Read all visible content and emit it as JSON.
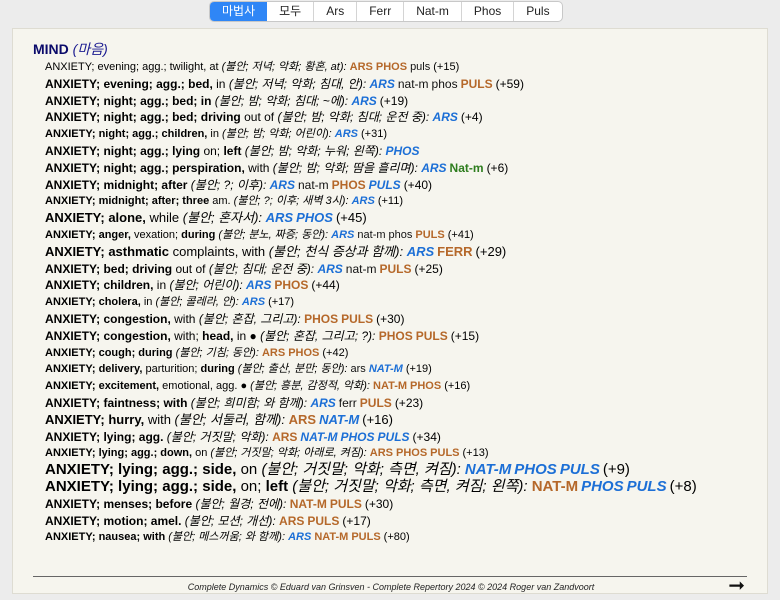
{
  "tabs": [
    {
      "label": "마법사",
      "active": true
    },
    {
      "label": "모두",
      "active": false
    },
    {
      "label": "Ars",
      "active": false
    },
    {
      "label": "Ferr",
      "active": false
    },
    {
      "label": "Nat-m",
      "active": false
    },
    {
      "label": "Phos",
      "active": false
    },
    {
      "label": "Puls",
      "active": false
    }
  ],
  "chapter": {
    "title": "MIND",
    "translation": "(마음)"
  },
  "rubrics": [
    {
      "size": 11,
      "parts": [
        {
          "t": "ANXIETY; evening; agg.; twilight, at ",
          "b": false
        }
      ],
      "tr": "(불안; 저녁; 악화; 황혼, at):",
      "rem": [
        [
          "ARS",
          "brown",
          1
        ],
        [
          "PHOS",
          "brown",
          1
        ],
        [
          "puls",
          "black",
          0
        ]
      ],
      "count": "(+15)"
    },
    {
      "size": 12,
      "parts": [
        {
          "t": "ANXIETY; evening; agg.; bed, ",
          "b": true
        },
        {
          "t": "in ",
          "b": false
        }
      ],
      "tr": "(불안; 저녁; 악화; 침대, 안):",
      "rem": [
        [
          "ARS",
          "blue",
          1
        ],
        [
          "nat-m",
          "black",
          0
        ],
        [
          "phos",
          "black",
          0
        ],
        [
          "PULS",
          "brown",
          1
        ]
      ],
      "count": "(+59)"
    },
    {
      "size": 12,
      "parts": [
        {
          "t": "ANXIETY; night; agg.; bed; in ",
          "b": true
        }
      ],
      "tr": "(불안; 밤; 악화; 침대; ~에):",
      "rem": [
        [
          "ARS",
          "blue",
          1
        ]
      ],
      "count": "(+19)"
    },
    {
      "size": 12,
      "parts": [
        {
          "t": "ANXIETY; night; agg.; bed; driving ",
          "b": true
        },
        {
          "t": "out of ",
          "b": false
        }
      ],
      "tr": "(불안; 밤; 악화; 침대; 운전 중):",
      "rem": [
        [
          "ARS",
          "blue",
          1
        ]
      ],
      "count": "(+4)"
    },
    {
      "size": 11,
      "parts": [
        {
          "t": "ANXIETY; night; agg.; children, ",
          "b": true
        },
        {
          "t": "in ",
          "b": false
        }
      ],
      "tr": "(불안; 밤; 악화; 어린이):",
      "rem": [
        [
          "ARS",
          "blue",
          1
        ]
      ],
      "count": "(+31)"
    },
    {
      "size": 12,
      "parts": [
        {
          "t": "ANXIETY; night; agg.; lying ",
          "b": true
        },
        {
          "t": "on; ",
          "b": false
        },
        {
          "t": "left ",
          "b": true
        }
      ],
      "tr": "(불안; 밤; 악화; 누워; 왼쪽):",
      "rem": [
        [
          "PHOS",
          "blue",
          1
        ]
      ],
      "count": ""
    },
    {
      "size": 12,
      "parts": [
        {
          "t": "ANXIETY; night; agg.; perspiration, ",
          "b": true
        },
        {
          "t": "with ",
          "b": false
        }
      ],
      "tr": "(불안; 밤; 악화; 땀을 흘리며):",
      "rem": [
        [
          "ARS",
          "blue",
          1
        ],
        [
          "Nat-m",
          "green",
          1
        ]
      ],
      "count": "(+6)"
    },
    {
      "size": 12,
      "parts": [
        {
          "t": "ANXIETY; midnight; after ",
          "b": true
        }
      ],
      "tr": "(불안; ?; 이후):",
      "rem": [
        [
          "ARS",
          "blue",
          1
        ],
        [
          "nat-m",
          "black",
          0
        ],
        [
          "PHOS",
          "brown",
          1
        ],
        [
          "PULS",
          "blue",
          1
        ]
      ],
      "count": "(+40)"
    },
    {
      "size": 11,
      "parts": [
        {
          "t": "ANXIETY; midnight; after; three ",
          "b": true
        },
        {
          "t": "am. ",
          "b": false
        }
      ],
      "tr": "(불안; ?; 이후; 새벽 3시):",
      "rem": [
        [
          "ARS",
          "blue",
          1
        ]
      ],
      "count": "(+11)"
    },
    {
      "size": 13,
      "parts": [
        {
          "t": "ANXIETY; alone, ",
          "b": true
        },
        {
          "t": "while ",
          "b": false
        }
      ],
      "tr": "(불안; 혼자서):",
      "rem": [
        [
          "ARS",
          "blue",
          1
        ],
        [
          "PHOS",
          "blue",
          1
        ]
      ],
      "count": "(+45)"
    },
    {
      "size": 11,
      "parts": [
        {
          "t": "ANXIETY; anger, ",
          "b": true
        },
        {
          "t": "vexation; ",
          "b": false
        },
        {
          "t": "during ",
          "b": true
        }
      ],
      "tr": "(불안; 분노, 짜증; 동안):",
      "rem": [
        [
          "ARS",
          "blue",
          1
        ],
        [
          "nat-m",
          "black",
          0
        ],
        [
          "phos",
          "black",
          0
        ],
        [
          "PULS",
          "brown",
          1
        ]
      ],
      "count": "(+41)"
    },
    {
      "size": 13,
      "parts": [
        {
          "t": "ANXIETY; asthmatic ",
          "b": true
        },
        {
          "t": "complaints, with ",
          "b": false
        }
      ],
      "tr": "(불안; 천식 증상과 함께):",
      "rem": [
        [
          "ARS",
          "blue",
          1
        ],
        [
          "FERR",
          "brown",
          1
        ]
      ],
      "count": "(+29)"
    },
    {
      "size": 12,
      "parts": [
        {
          "t": "ANXIETY; bed; driving ",
          "b": true
        },
        {
          "t": "out of ",
          "b": false
        }
      ],
      "tr": "(불안; 침대; 운전 중):",
      "rem": [
        [
          "ARS",
          "blue",
          1
        ],
        [
          "nat-m",
          "black",
          0
        ],
        [
          "PULS",
          "brown",
          1
        ]
      ],
      "count": "(+25)"
    },
    {
      "size": 12,
      "parts": [
        {
          "t": "ANXIETY; children, ",
          "b": true
        },
        {
          "t": "in ",
          "b": false
        }
      ],
      "tr": "(불안; 어린이):",
      "rem": [
        [
          "ARS",
          "blue",
          1
        ],
        [
          "PHOS",
          "brown",
          1
        ]
      ],
      "count": "(+44)"
    },
    {
      "size": 11,
      "parts": [
        {
          "t": "ANXIETY; cholera, ",
          "b": true
        },
        {
          "t": "in ",
          "b": false
        }
      ],
      "tr": "(불안; 콜레라, 안):",
      "rem": [
        [
          "ARS",
          "blue",
          1
        ]
      ],
      "count": "(+17)"
    },
    {
      "size": 12,
      "parts": [
        {
          "t": "ANXIETY; congestion, ",
          "b": true
        },
        {
          "t": "with ",
          "b": false
        }
      ],
      "tr": "(불안; 혼잡, 그리고):",
      "rem": [
        [
          "PHOS",
          "brown",
          1
        ],
        [
          "PULS",
          "brown",
          1
        ]
      ],
      "count": "(+30)"
    },
    {
      "size": 12,
      "parts": [
        {
          "t": "ANXIETY; congestion, ",
          "b": true
        },
        {
          "t": "with; ",
          "b": false
        },
        {
          "t": "head, ",
          "b": true
        },
        {
          "t": "in ● ",
          "b": false
        }
      ],
      "tr": "(불안; 혼잡, 그리고; ?):",
      "rem": [
        [
          "PHOS",
          "brown",
          1
        ],
        [
          "PULS",
          "brown",
          1
        ]
      ],
      "count": "(+15)"
    },
    {
      "size": 11,
      "parts": [
        {
          "t": "ANXIETY; cough; during ",
          "b": true
        }
      ],
      "tr": "(불안; 기침; 동안):",
      "rem": [
        [
          "ARS",
          "brown",
          1
        ],
        [
          "PHOS",
          "brown",
          1
        ]
      ],
      "count": "(+42)"
    },
    {
      "size": 11,
      "parts": [
        {
          "t": "ANXIETY; delivery, ",
          "b": true
        },
        {
          "t": "parturition; ",
          "b": false
        },
        {
          "t": "during ",
          "b": true
        }
      ],
      "tr": "(불안; 출산, 분만; 동안):",
      "rem": [
        [
          "ars",
          "black",
          0
        ],
        [
          "NAT-M",
          "blue",
          1
        ]
      ],
      "count": "(+19)"
    },
    {
      "size": 11,
      "parts": [
        {
          "t": "ANXIETY; excitement, ",
          "b": true
        },
        {
          "t": "emotional, agg. ● ",
          "b": false
        }
      ],
      "tr": "(불안; 흥분, 감정적, 악화):",
      "rem": [
        [
          "NAT-M",
          "brown",
          1
        ],
        [
          "PHOS",
          "brown",
          1
        ]
      ],
      "count": "(+16)"
    },
    {
      "size": 12,
      "parts": [
        {
          "t": "ANXIETY; faintness; with ",
          "b": true
        }
      ],
      "tr": "(불안; 희미함; 와 함께):",
      "rem": [
        [
          "ARS",
          "blue",
          1
        ],
        [
          "ferr",
          "black",
          0
        ],
        [
          "PULS",
          "brown",
          1
        ]
      ],
      "count": "(+23)"
    },
    {
      "size": 13,
      "parts": [
        {
          "t": "ANXIETY; hurry, ",
          "b": true
        },
        {
          "t": "with ",
          "b": false
        }
      ],
      "tr": "(불안; 서둘러, 함께):",
      "rem": [
        [
          "ARS",
          "brown",
          1
        ],
        [
          "NAT-M",
          "blue",
          1
        ]
      ],
      "count": "(+16)"
    },
    {
      "size": 12,
      "parts": [
        {
          "t": "ANXIETY; lying; agg. ",
          "b": true
        }
      ],
      "tr": "(불안; 거짓말; 악화):",
      "rem": [
        [
          "ARS",
          "brown",
          1
        ],
        [
          "NAT-M",
          "blue",
          1
        ],
        [
          "PHOS",
          "blue",
          1
        ],
        [
          "PULS",
          "blue",
          1
        ]
      ],
      "count": "(+34)"
    },
    {
      "size": 11,
      "parts": [
        {
          "t": "ANXIETY; lying; agg.; down, ",
          "b": true
        },
        {
          "t": "on ",
          "b": false
        }
      ],
      "tr": "(불안; 거짓말; 악화; 아래로, 켜짐):",
      "rem": [
        [
          "ARS",
          "brown",
          1
        ],
        [
          "PHOS",
          "brown",
          1
        ],
        [
          "PULS",
          "brown",
          1
        ]
      ],
      "count": "(+13)"
    },
    {
      "size": 15,
      "parts": [
        {
          "t": "ANXIETY; lying; agg.; side, ",
          "b": true
        },
        {
          "t": "on ",
          "b": false
        }
      ],
      "tr": "(불안; 거짓말; 악화; 측면, 켜짐):",
      "rem": [
        [
          "NAT-M",
          "blue",
          1
        ],
        [
          "PHOS",
          "blue",
          1
        ],
        [
          "PULS",
          "blue",
          1
        ]
      ],
      "count": "(+9)"
    },
    {
      "size": 15,
      "parts": [
        {
          "t": "ANXIETY; lying; agg.; side, ",
          "b": true
        },
        {
          "t": "on; ",
          "b": false
        },
        {
          "t": "left ",
          "b": true
        }
      ],
      "tr": "(불안; 거짓말; 악화; 측면, 켜짐; 왼쪽):",
      "rem": [
        [
          "NAT-M",
          "brown",
          1
        ],
        [
          "PHOS",
          "blue",
          1
        ],
        [
          "PULS",
          "blue",
          1
        ]
      ],
      "count": "(+8)"
    },
    {
      "size": 12,
      "parts": [
        {
          "t": "ANXIETY; menses; before ",
          "b": true
        }
      ],
      "tr": "(불안; 월경; 전에):",
      "rem": [
        [
          "NAT-M",
          "brown",
          1
        ],
        [
          "PULS",
          "brown",
          1
        ]
      ],
      "count": "(+30)"
    },
    {
      "size": 12,
      "parts": [
        {
          "t": "ANXIETY; motion; amel. ",
          "b": true
        }
      ],
      "tr": "(불안; 모션; 개선):",
      "rem": [
        [
          "ARS",
          "brown",
          1
        ],
        [
          "PULS",
          "brown",
          1
        ]
      ],
      "count": "(+17)"
    },
    {
      "size": 11,
      "parts": [
        {
          "t": "ANXIETY; nausea; with ",
          "b": true
        }
      ],
      "tr": "(불안; 메스꺼움; 와 함께):",
      "rem": [
        [
          "ARS",
          "blue",
          1
        ],
        [
          "NAT-M",
          "brown",
          1
        ],
        [
          "PULS",
          "brown",
          1
        ]
      ],
      "count": "(+80)"
    }
  ],
  "footer": "Complete Dynamics © Eduard van Grinsven   -   Complete Repertory 2024 © 2024 Roger van Zandvoort",
  "next_arrow": "➞"
}
